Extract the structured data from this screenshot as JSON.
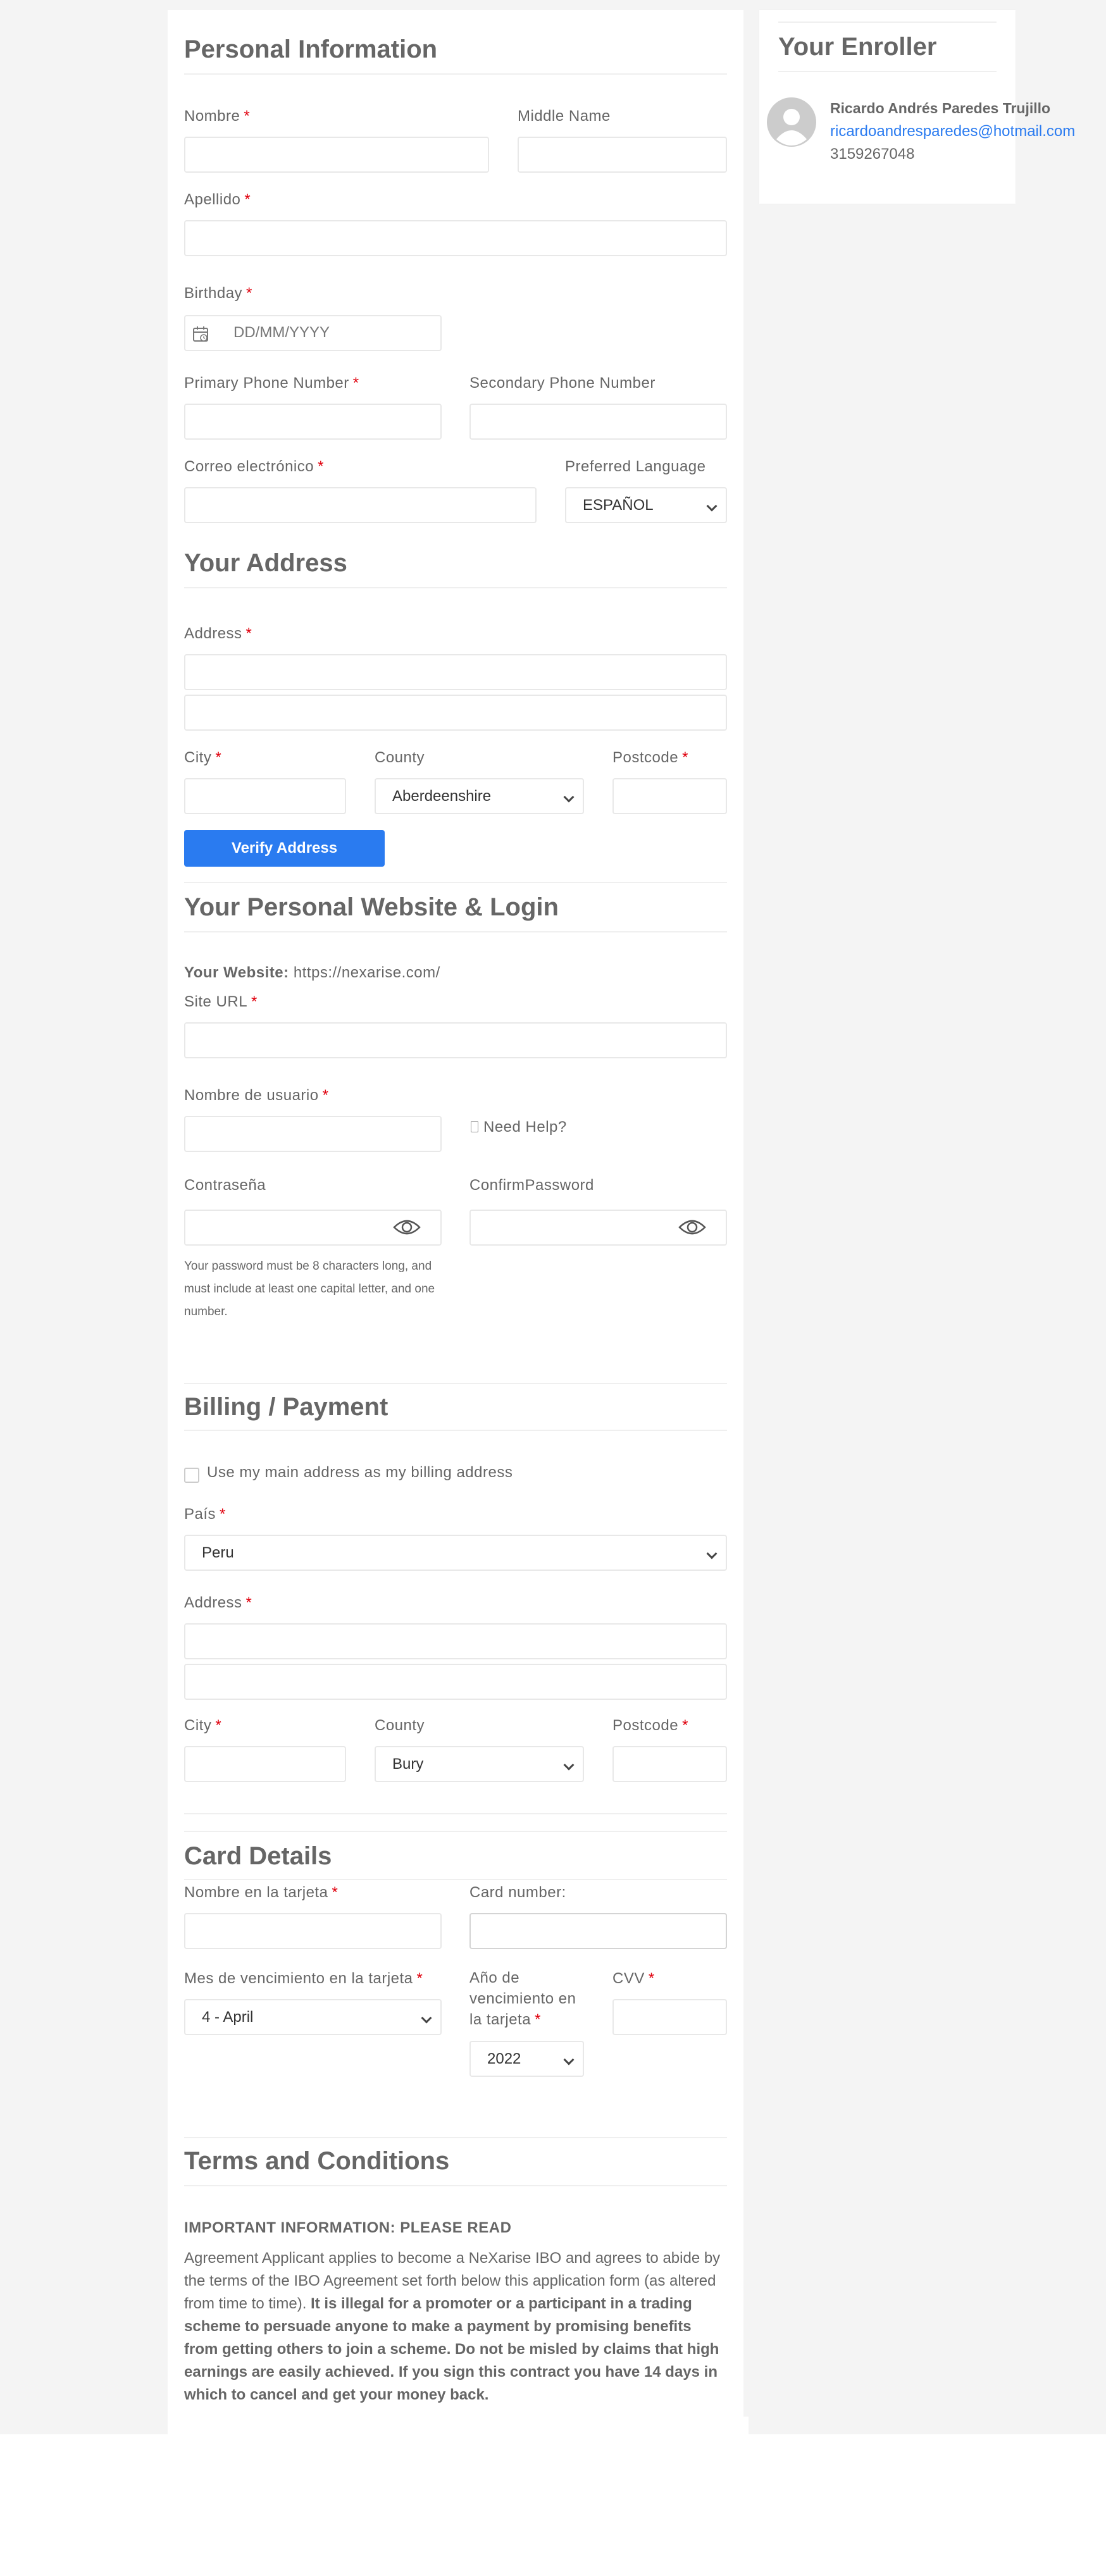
{
  "personal": {
    "title": "Personal Information",
    "nombre_label": "Nombre",
    "middle_label": "Middle Name",
    "apellido_label": "Apellido",
    "birthday_label": "Birthday",
    "birthday_placeholder": "DD/MM/YYYY",
    "primary_phone_label": "Primary Phone Number",
    "secondary_phone_label": "Secondary Phone Number",
    "email_label": "Correo electrónico",
    "language_label": "Preferred Language",
    "language_value": "ESPAÑOL"
  },
  "address": {
    "title": "Your Address",
    "address_label": "Address",
    "city_label": "City",
    "county_label": "County",
    "county_value": "Aberdeenshire",
    "postcode_label": "Postcode",
    "verify_button": "Verify Address"
  },
  "website": {
    "title": "Your Personal Website & Login",
    "website_prefix": "Your Website:",
    "website_url": "https://nexarise.com/",
    "site_url_label": "Site URL",
    "username_label": "Nombre de usuario",
    "need_help": "Need Help?",
    "password_label": "Contraseña",
    "confirm_label": "ConfirmPassword",
    "password_help_1": "Your password must be 8 characters long, and",
    "password_help_2": "must include at least one capital letter, and one",
    "password_help_3": "number."
  },
  "billing": {
    "title": "Billing / Payment",
    "use_main_address": "Use my main address as my billing address",
    "country_label": "País",
    "country_value": "Peru",
    "address_label": "Address",
    "city_label": "City",
    "county_label": "County",
    "county_value": "Bury",
    "postcode_label": "Postcode"
  },
  "card": {
    "title": "Card Details",
    "name_label": "Nombre en la tarjeta",
    "number_label": "Card number:",
    "month_label": "Mes de vencimiento en la tarjeta",
    "month_value": "4 - April",
    "year_label_1": "Año de",
    "year_label_2": "vencimiento en",
    "year_label_3": "la tarjeta",
    "year_value": "2022",
    "cvv_label": "CVV"
  },
  "terms": {
    "title": "Terms and Conditions",
    "important": "IMPORTANT INFORMATION: PLEASE READ",
    "line1": "Agreement Applicant applies to become a NeXarise IBO and agrees to abide by",
    "line2": "the terms of the IBO Agreement set forth below this application form (as altered",
    "line3_normal": "from time to time). ",
    "line3_bold": "It is illegal for a promoter or a participant in a trading",
    "line4": "scheme to persuade anyone to make a payment by promising benefits",
    "line5": "from getting others to join a scheme. Do not be misled by claims that high",
    "line6": "earnings are easily achieved. If you sign this contract you have 14 days in",
    "line7": "which to cancel and get your money back."
  },
  "enroller": {
    "title": "Your Enroller",
    "name": "Ricardo Andrés Paredes Trujillo",
    "email": "ricardoandresparedes@hotmail.com",
    "phone": "3159267048"
  },
  "required_mark": "*",
  "colors": {
    "accent": "#2a7bf0",
    "required": "#e0000d",
    "text": "#666666",
    "link": "#2a7bf0"
  }
}
